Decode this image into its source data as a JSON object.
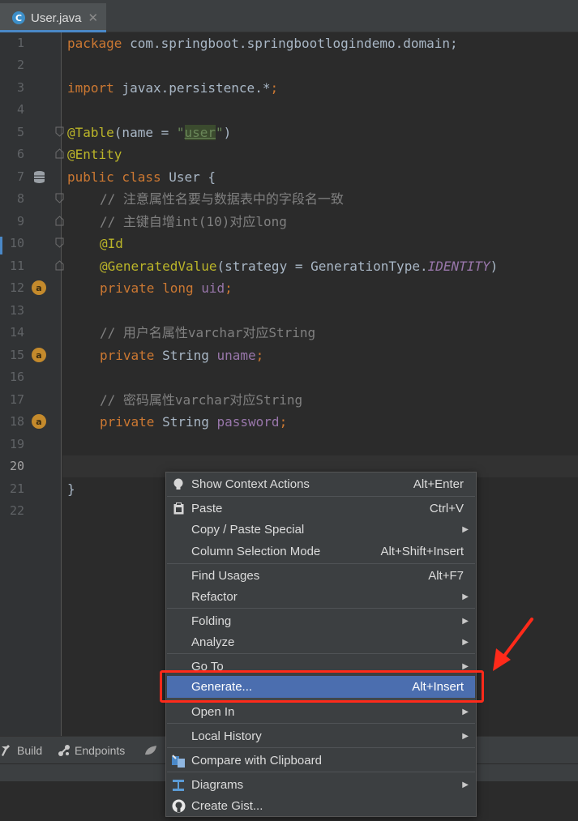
{
  "editor_tab": {
    "label": "User.java",
    "icon": "class-c-icon",
    "close": "✕"
  },
  "gutter": {
    "line_numbers": [
      "1",
      "2",
      "3",
      "4",
      "5",
      "6",
      "7",
      "8",
      "9",
      "10",
      "11",
      "12",
      "13",
      "14",
      "15",
      "16",
      "17",
      "18",
      "19",
      "20",
      "21",
      "22"
    ],
    "current_line": "20"
  },
  "code": {
    "l1": {
      "kw": "package",
      "rest": " com.springboot.springbootlogindemo.domain;"
    },
    "l3": {
      "kw": "import",
      "rest": " javax.persistence.*",
      "semi": ";"
    },
    "l5": {
      "ann": "@Table",
      "a": "(name = ",
      "q1": "\"",
      "inj": "user",
      "q2": "\"",
      "b": ")"
    },
    "l6": {
      "ann": "@Entity"
    },
    "l7": {
      "kw": "public class ",
      "cls": "User",
      "rest": " {"
    },
    "l8": {
      "cmt": "// 注意属性名要与数据表中的字段名一致"
    },
    "l9": {
      "cmt": "// 主键自增int(10)对应long"
    },
    "l10": {
      "ann": "@Id"
    },
    "l11": {
      "ann": "@GeneratedValue",
      "a": "(strategy = GenerationType.",
      "ital": "IDENTITY",
      "b": ")"
    },
    "l12": {
      "kw": "private long ",
      "fld": "uid",
      "semi": ";"
    },
    "l14": {
      "cmt": "// 用户名属性varchar对应String"
    },
    "l15": {
      "kw": "private ",
      "typ": "String ",
      "fld": "uname",
      "semi": ";"
    },
    "l17": {
      "cmt": "// 密码属性varchar对应String"
    },
    "l18": {
      "kw": "private ",
      "typ": "String ",
      "fld": "password",
      "semi": ";"
    },
    "l21": {
      "rest": "}"
    }
  },
  "context_menu": [
    {
      "label": "Show Context Actions",
      "shortcut": "Alt+Enter",
      "icon": "lightbulb-icon"
    },
    {
      "label": "Paste",
      "shortcut": "Ctrl+V",
      "icon": "clipboard-icon"
    },
    {
      "label": "Copy / Paste Special",
      "submenu": "▶"
    },
    {
      "label": "Column Selection Mode",
      "shortcut": "Alt+Shift+Insert"
    },
    {
      "label": "Find Usages",
      "shortcut": "Alt+F7"
    },
    {
      "label": "Refactor",
      "submenu": "▶"
    },
    {
      "label": "Folding",
      "submenu": "▶"
    },
    {
      "label": "Analyze",
      "submenu": "▶"
    },
    {
      "label": "Go To",
      "submenu": "▶"
    },
    {
      "label": "Generate...",
      "shortcut": "Alt+Insert",
      "selected": true
    },
    {
      "label": "Open In",
      "submenu": "▶"
    },
    {
      "label": "Local History",
      "submenu": "▶"
    },
    {
      "label": "Compare with Clipboard",
      "icon": "compare-icon"
    },
    {
      "label": "Diagrams",
      "submenu": "▶",
      "icon": "diagram-icon"
    },
    {
      "label": "Create Gist...",
      "icon": "github-icon"
    }
  ],
  "tool_windows": [
    {
      "label": "Build",
      "icon": "hammer-icon"
    },
    {
      "label": "Endpoints",
      "icon": "endpoints-icon"
    }
  ],
  "colors": {
    "editor_bg": "#2b2b2b",
    "keyword": "#cc7832",
    "annotation": "#bbb529",
    "string": "#6a8759",
    "comment": "#808080",
    "field": "#9876aa",
    "menu_selected": "#4b6eaf",
    "highlight": "#ff2a1a"
  }
}
